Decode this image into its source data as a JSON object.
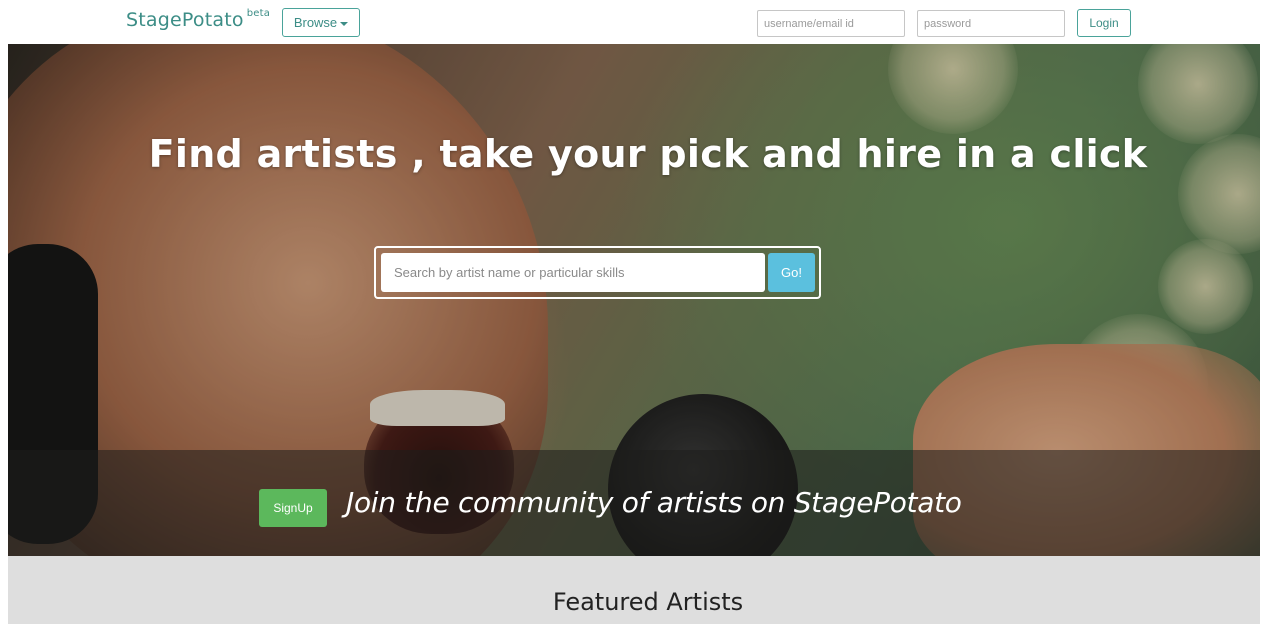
{
  "navbar": {
    "brand": "StagePotato",
    "brand_badge": "beta",
    "browse_label": "Browse",
    "username_placeholder": "username/email id",
    "password_placeholder": "password",
    "login_label": "Login"
  },
  "hero": {
    "title": "Find artists , take your pick and hire in a click",
    "search_placeholder": "Search by artist name or particular skills",
    "go_label": "Go!",
    "signup_label": "SignUp",
    "join_text": "Join the community of artists on StagePotato"
  },
  "featured": {
    "title": "Featured Artists"
  },
  "icons": {
    "browse_caret": "chevron-down-icon"
  },
  "colors": {
    "brand": "#3c8d86",
    "go_button": "#5bc0de",
    "signup_button": "#5cb85c",
    "featured_background": "#dedede"
  }
}
